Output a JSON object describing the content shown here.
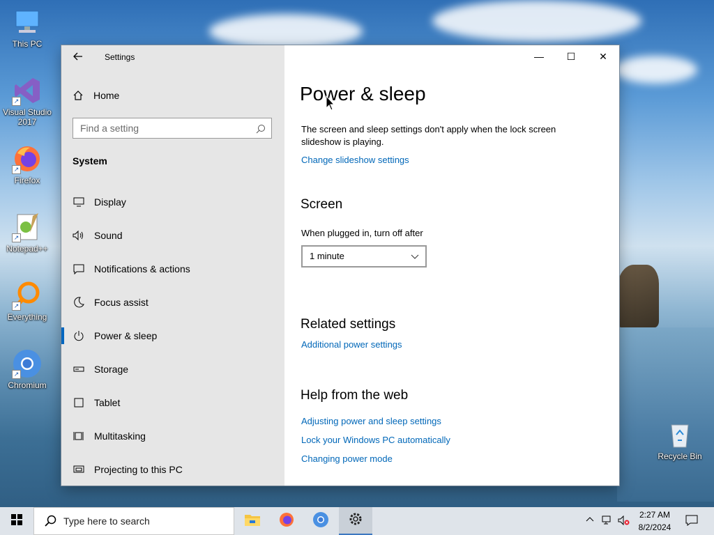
{
  "desktop": {
    "icons": [
      {
        "label": "This PC",
        "icon": "computer-icon"
      },
      {
        "label": "Visual Studio 2017",
        "icon": "visual-studio-icon"
      },
      {
        "label": "Firefox",
        "icon": "firefox-icon"
      },
      {
        "label": "Notepad++",
        "icon": "notepadpp-icon"
      },
      {
        "label": "Everything",
        "icon": "everything-icon"
      },
      {
        "label": "Chromium",
        "icon": "chromium-icon"
      },
      {
        "label": "Recycle Bin",
        "icon": "recycle-bin-icon"
      }
    ]
  },
  "window": {
    "title": "Settings",
    "controls": {
      "minimize": "—",
      "maximize": "☐",
      "close": "✕"
    }
  },
  "sidebar": {
    "home_label": "Home",
    "search_placeholder": "Find a setting",
    "section_title": "System",
    "items": [
      {
        "label": "Display",
        "icon": "display-icon"
      },
      {
        "label": "Sound",
        "icon": "sound-icon"
      },
      {
        "label": "Notifications & actions",
        "icon": "notifications-icon"
      },
      {
        "label": "Focus assist",
        "icon": "moon-icon"
      },
      {
        "label": "Power & sleep",
        "icon": "power-icon",
        "active": true
      },
      {
        "label": "Storage",
        "icon": "storage-icon"
      },
      {
        "label": "Tablet",
        "icon": "tablet-icon"
      },
      {
        "label": "Multitasking",
        "icon": "multitasking-icon"
      },
      {
        "label": "Projecting to this PC",
        "icon": "projecting-icon"
      }
    ]
  },
  "main": {
    "page_title": "Power & sleep",
    "lock_screen_note": "The screen and sleep settings don't apply when the lock screen slideshow is playing.",
    "slideshow_link": "Change slideshow settings",
    "screen_heading": "Screen",
    "plugged_in_label": "When plugged in, turn off after",
    "plugged_in_value": "1 minute",
    "related_heading": "Related settings",
    "additional_power_link": "Additional power settings",
    "help_heading": "Help from the web",
    "help_links": [
      "Adjusting power and sleep settings",
      "Lock your Windows PC automatically",
      "Changing power mode"
    ]
  },
  "taskbar": {
    "search_placeholder": "Type here to search",
    "pinned": [
      "file-explorer-icon",
      "firefox-icon",
      "chromium-icon",
      "settings-icon"
    ],
    "clock_time": "2:27 AM",
    "clock_date": "8/2/2024"
  },
  "colors": {
    "accent": "#0067c0",
    "link": "#0067b8",
    "sidebar_bg": "#e6e6e6"
  }
}
